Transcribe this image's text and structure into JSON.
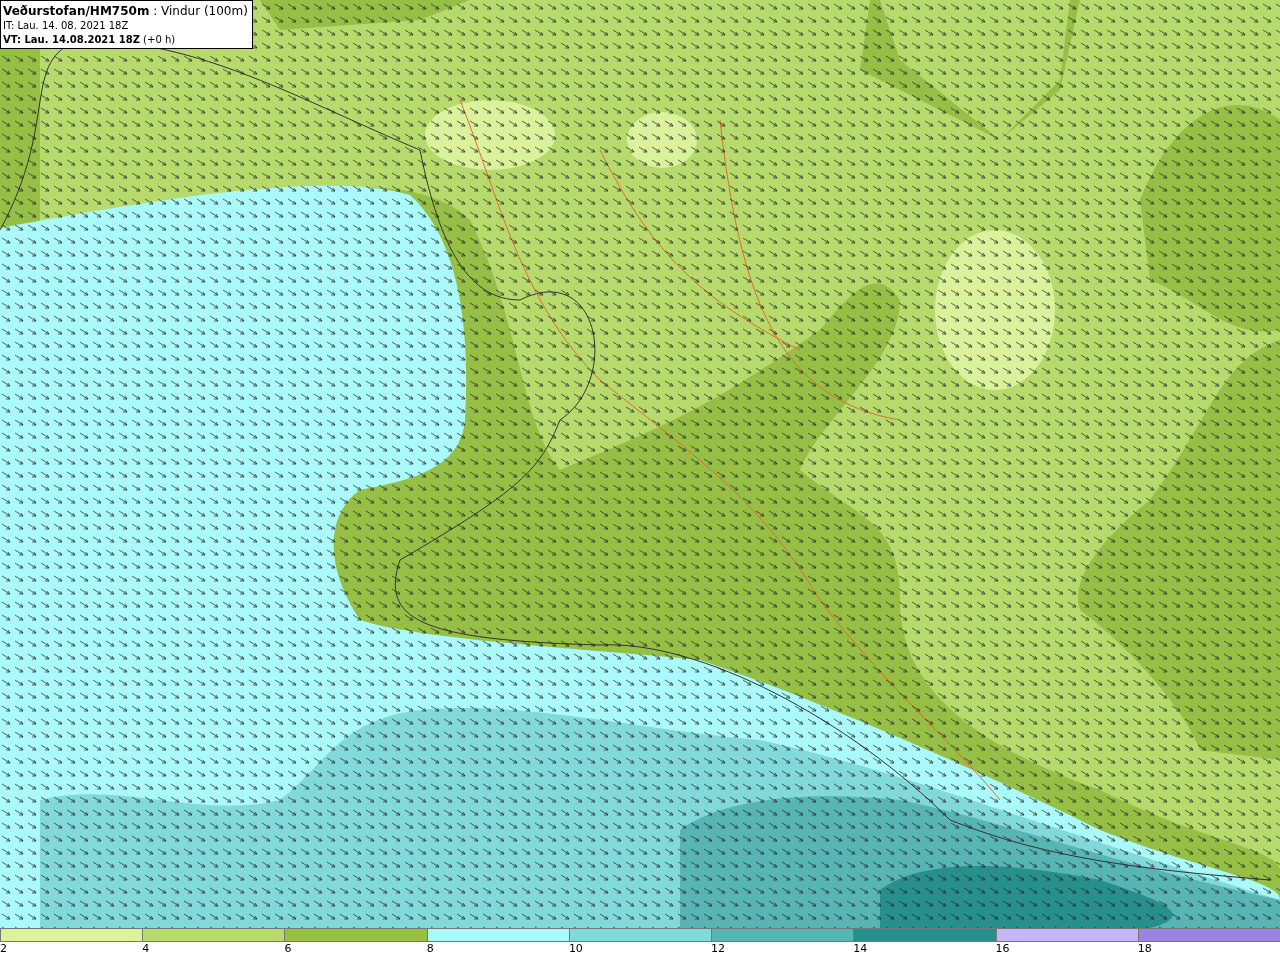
{
  "info_box": {
    "lines": [
      "**Veðurstofan/HM750m** : Vindur (100m)",
      "IT: Lau. 14. 08. 2021 18Z",
      "**VT: Lau. 14.08.2021 18Z** (+0 h)"
    ]
  },
  "legend": [
    {
      "label": "2",
      "color": "#d9f29b"
    },
    {
      "label": "4",
      "color": "#b7da6d"
    },
    {
      "label": "6",
      "color": "#96bf45"
    },
    {
      "label": "8",
      "color": "#aaf9fb"
    },
    {
      "label": "10",
      "color": "#82d9da"
    },
    {
      "label": "12",
      "color": "#57b5b4"
    },
    {
      "label": "14",
      "color": "#27908d"
    },
    {
      "label": "16",
      "color": "#c5b6f5"
    },
    {
      "label": "18",
      "color": "#9b84e0"
    }
  ]
}
